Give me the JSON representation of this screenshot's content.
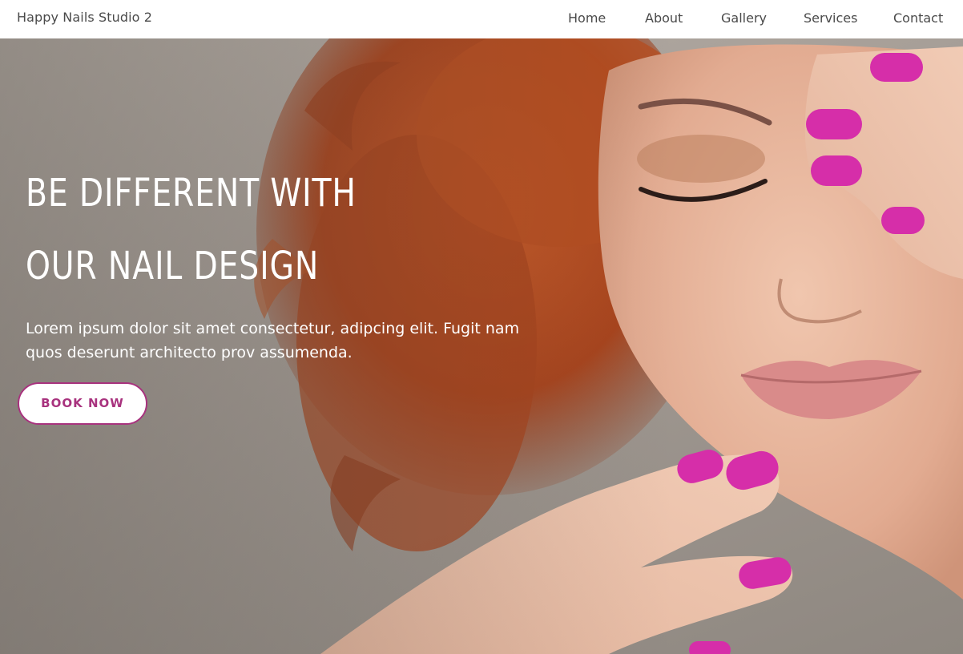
{
  "brand": "Happy Nails Studio 2",
  "nav": {
    "home": "Home",
    "about": "About",
    "gallery": "Gallery",
    "services": "Services",
    "contact": "Contact"
  },
  "hero": {
    "headline_line1": "BE DIFFERENT WITH",
    "headline_line2": "OUR NAIL DESIGN",
    "subtext": "Lorem ipsum dolor sit amet consectetur, adipcing elit. Fugit nam quos deserunt architecto prov assumenda.",
    "cta_label": "BOOK NOW"
  },
  "colors": {
    "accent": "#a8327e",
    "nail": "#d62ea9",
    "hair": "#b24a22",
    "skin": "#e8b59c",
    "text_dark": "#4a4a4a"
  }
}
